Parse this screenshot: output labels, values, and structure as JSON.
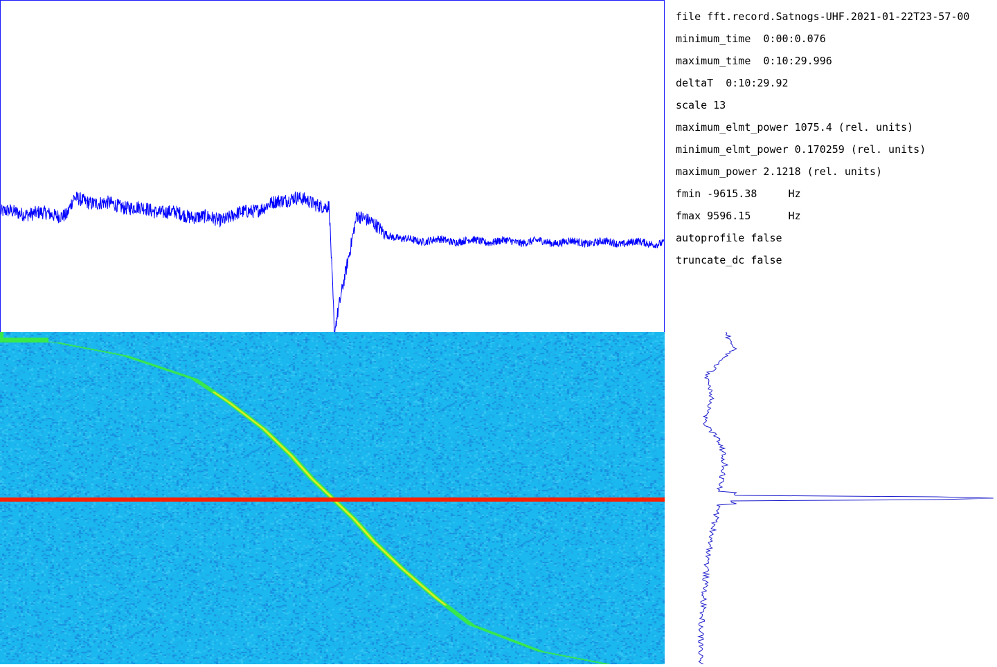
{
  "info": {
    "lines": [
      "file fft.record.Satnogs-UHF.2021-01-22T23-57-00",
      "minimum_time  0:00:0.076",
      "maximum_time  0:10:29.996",
      "deltaT  0:10:29.92",
      "scale 13",
      "maximum_elmt_power 1075.4 (rel. units)",
      "minimum_elmt_power 0.170259 (rel. units)",
      "maximum_power 2.1218 (rel. units)",
      "fmin -9615.38     Hz",
      "fmax 9596.15      Hz",
      "autoprofile false",
      "truncate_dc false"
    ]
  },
  "colors": {
    "trace": "#0000ff",
    "waterfall_background": "#1ab8ef",
    "signal_track": "#39e84a",
    "signal_peak": "#e8f020",
    "cursor_line": "#ff2000",
    "profile_trace": "#1a1acc"
  },
  "chart_data": [
    {
      "type": "line",
      "name": "power-spectrum",
      "x_range": [
        -9615.38,
        9596.15
      ],
      "y_range": [
        0,
        2.1218
      ],
      "notes": "noisy power trace; elevated roughly 0.75-0.87 of max for f < 0, dropping to ~0.58 for f > 1500 Hz; sharp downward spike near f ≈ 55 Hz",
      "segments": [
        {
          "x": [
            -9615.38,
            -7700,
            -7500,
            -5200,
            -3300,
            -2000,
            -1100,
            -600,
            -100,
            50,
            700,
            1500,
            2000,
            5000,
            9596.15
          ],
          "y": [
            0.77,
            0.75,
            0.85,
            0.78,
            0.72,
            0.8,
            0.87,
            0.82,
            0.81,
            0.0,
            0.76,
            0.64,
            0.59,
            0.58,
            0.57
          ]
        }
      ]
    },
    {
      "type": "heatmap",
      "name": "waterfall",
      "x_range": [
        -9615.38,
        9596.15
      ],
      "time_range": [
        "0:00:0.076",
        "0:10:29.996"
      ],
      "signal_track": {
        "frequency_hz": [
          -9615.38,
          -8000,
          -6000,
          -4000,
          -3000,
          -2000,
          -1200,
          -600,
          0,
          600,
          1200,
          2000,
          3000,
          4000,
          6000,
          8000
        ],
        "time_fraction": [
          0.02,
          0.03,
          0.07,
          0.14,
          0.21,
          0.29,
          0.37,
          0.44,
          0.5,
          0.56,
          0.63,
          0.71,
          0.8,
          0.88,
          0.96,
          1.0
        ]
      },
      "cursor_time_fraction": 0.5
    },
    {
      "type": "line",
      "name": "time-profile",
      "notes": "vertical profile of power vs time; spike at cursor time",
      "time_fraction": [
        0.01,
        0.05,
        0.13,
        0.2,
        0.27,
        0.34,
        0.4,
        0.48,
        0.5,
        0.52,
        0.6,
        0.7,
        0.8,
        0.9,
        0.99
      ],
      "value": [
        0.1,
        0.12,
        0.03,
        0.05,
        0.02,
        0.08,
        0.09,
        0.07,
        1.0,
        0.07,
        0.05,
        0.03,
        0.02,
        0.01,
        0.01
      ]
    }
  ]
}
